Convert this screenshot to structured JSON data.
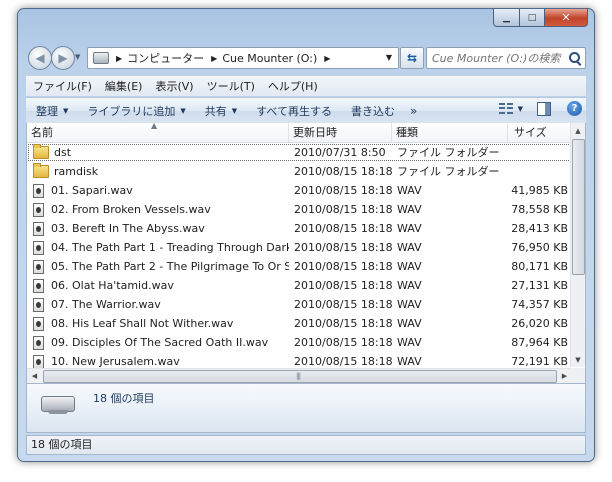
{
  "window": {
    "caption": {
      "minimize": "▁",
      "maximize": "□",
      "close": "✕"
    }
  },
  "navigation": {
    "path": [
      "コンピューター",
      "Cue Mounter (O:)"
    ],
    "search_placeholder": "Cue Mounter (O:)の検索"
  },
  "menubar": {
    "items": [
      "ファイル(F)",
      "編集(E)",
      "表示(V)",
      "ツール(T)",
      "ヘルプ(H)"
    ]
  },
  "toolbar": {
    "organize": "整理",
    "add_to_library": "ライブラリに追加",
    "share": "共有",
    "play_all": "すべて再生する",
    "burn": "書き込む",
    "more": "»"
  },
  "columns": {
    "name": "名前",
    "date": "更新日時",
    "type": "種類",
    "size": "サイズ"
  },
  "files": [
    {
      "name": "dst",
      "date": "2010/07/31 8:50",
      "type": "ファイル フォルダー",
      "size": "",
      "icon": "folder-icon"
    },
    {
      "name": "ramdisk",
      "date": "2010/08/15 18:18",
      "type": "ファイル フォルダー",
      "size": "",
      "icon": "folder-icon"
    },
    {
      "name": "01. Sapari.wav",
      "date": "2010/08/15 18:18",
      "type": "WAV",
      "size": "41,985 KB",
      "icon": "wav-icon"
    },
    {
      "name": "02. From Broken Vessels.wav",
      "date": "2010/08/15 18:18",
      "type": "WAV",
      "size": "78,558 KB",
      "icon": "wav-icon"
    },
    {
      "name": "03. Bereft In The Abyss.wav",
      "date": "2010/08/15 18:18",
      "type": "WAV",
      "size": "28,413 KB",
      "icon": "wav-icon"
    },
    {
      "name": "04. The Path Part 1 - Treading Through Dark...",
      "date": "2010/08/15 18:18",
      "type": "WAV",
      "size": "76,950 KB",
      "icon": "wav-icon"
    },
    {
      "name": "05. The Path Part 2 - The Pilgrimage To Or S...",
      "date": "2010/08/15 18:18",
      "type": "WAV",
      "size": "80,171 KB",
      "icon": "wav-icon"
    },
    {
      "name": "06. Olat Ha'tamid.wav",
      "date": "2010/08/15 18:18",
      "type": "WAV",
      "size": "27,131 KB",
      "icon": "wav-icon"
    },
    {
      "name": "07. The Warrior.wav",
      "date": "2010/08/15 18:18",
      "type": "WAV",
      "size": "74,357 KB",
      "icon": "wav-icon"
    },
    {
      "name": "08. His Leaf Shall Not Wither.wav",
      "date": "2010/08/15 18:18",
      "type": "WAV",
      "size": "26,020 KB",
      "icon": "wav-icon"
    },
    {
      "name": "09. Disciples Of The Sacred Oath II.wav",
      "date": "2010/08/15 18:18",
      "type": "WAV",
      "size": "87,964 KB",
      "icon": "wav-icon"
    },
    {
      "name": "10. New Jerusalem.wav",
      "date": "2010/08/15 18:18",
      "type": "WAV",
      "size": "72,191 KB",
      "icon": "wav-icon"
    }
  ],
  "details": {
    "item_count": "18 個の項目"
  },
  "status": {
    "item_count": "18 個の項目"
  }
}
